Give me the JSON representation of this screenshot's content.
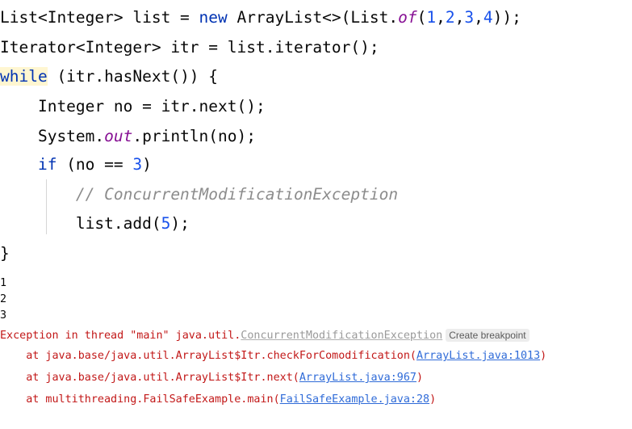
{
  "editor": {
    "lines": [
      {
        "tokens": [
          {
            "t": "List<Integer> list = ",
            "c": "plain"
          },
          {
            "t": "new",
            "c": "kw"
          },
          {
            "t": " ArrayList<>(List.",
            "c": "plain"
          },
          {
            "t": "of",
            "c": "static"
          },
          {
            "t": "(",
            "c": "plain"
          },
          {
            "t": "1",
            "c": "num"
          },
          {
            "t": ",",
            "c": "plain"
          },
          {
            "t": "2",
            "c": "num"
          },
          {
            "t": ",",
            "c": "plain"
          },
          {
            "t": "3",
            "c": "num"
          },
          {
            "t": ",",
            "c": "plain"
          },
          {
            "t": "4",
            "c": "num"
          },
          {
            "t": "));",
            "c": "plain"
          }
        ]
      },
      {
        "tokens": [
          {
            "t": "Iterator<Integer> itr = list.iterator();",
            "c": "plain"
          }
        ]
      },
      {
        "tokens": [
          {
            "t": "while",
            "c": "kw-hl"
          },
          {
            "t": " (itr.hasNext()) {",
            "c": "plain"
          }
        ]
      },
      {
        "tokens": [
          {
            "t": "    Integer no = itr.next();",
            "c": "plain"
          }
        ]
      },
      {
        "tokens": [
          {
            "t": "    System.",
            "c": "plain"
          },
          {
            "t": "out",
            "c": "static"
          },
          {
            "t": ".println(no);",
            "c": "plain"
          }
        ]
      },
      {
        "tokens": [
          {
            "t": "    ",
            "c": "plain"
          },
          {
            "t": "if",
            "c": "kw"
          },
          {
            "t": " (no == ",
            "c": "plain"
          },
          {
            "t": "3",
            "c": "num"
          },
          {
            "t": ")",
            "c": "plain"
          }
        ]
      },
      {
        "tokens": [
          {
            "t": "        ",
            "c": "plain"
          },
          {
            "t": "// ConcurrentModificationException",
            "c": "comment"
          }
        ]
      },
      {
        "tokens": [
          {
            "t": "        list.add(",
            "c": "plain"
          },
          {
            "t": "5",
            "c": "num"
          },
          {
            "t": ");",
            "c": "plain"
          }
        ]
      },
      {
        "tokens": [
          {
            "t": "}",
            "c": "plain"
          }
        ]
      }
    ]
  },
  "console": {
    "stdout": [
      "1",
      "2",
      "3"
    ],
    "exception": {
      "prefix": "Exception in thread \"main\" java.util.",
      "class_link": "ConcurrentModificationException",
      "breakpoint_label": "Create breakpoint"
    },
    "stack": [
      {
        "prefix": "    at java.base/java.util.ArrayList$Itr.checkForComodification(",
        "link": "ArrayList.java:1013",
        "suffix": ")"
      },
      {
        "prefix": "    at java.base/java.util.ArrayList$Itr.next(",
        "link": "ArrayList.java:967",
        "suffix": ")"
      },
      {
        "prefix": "    at multithreading.FailSafeExample.main(",
        "link": "FailSafeExample.java:28",
        "suffix": ")"
      }
    ]
  },
  "colors": {
    "keyword": "#0033b3",
    "number": "#1750eb",
    "static_member": "#871094",
    "comment": "#8c8c8c",
    "error": "#c21818",
    "link": "#2f6bd8"
  }
}
